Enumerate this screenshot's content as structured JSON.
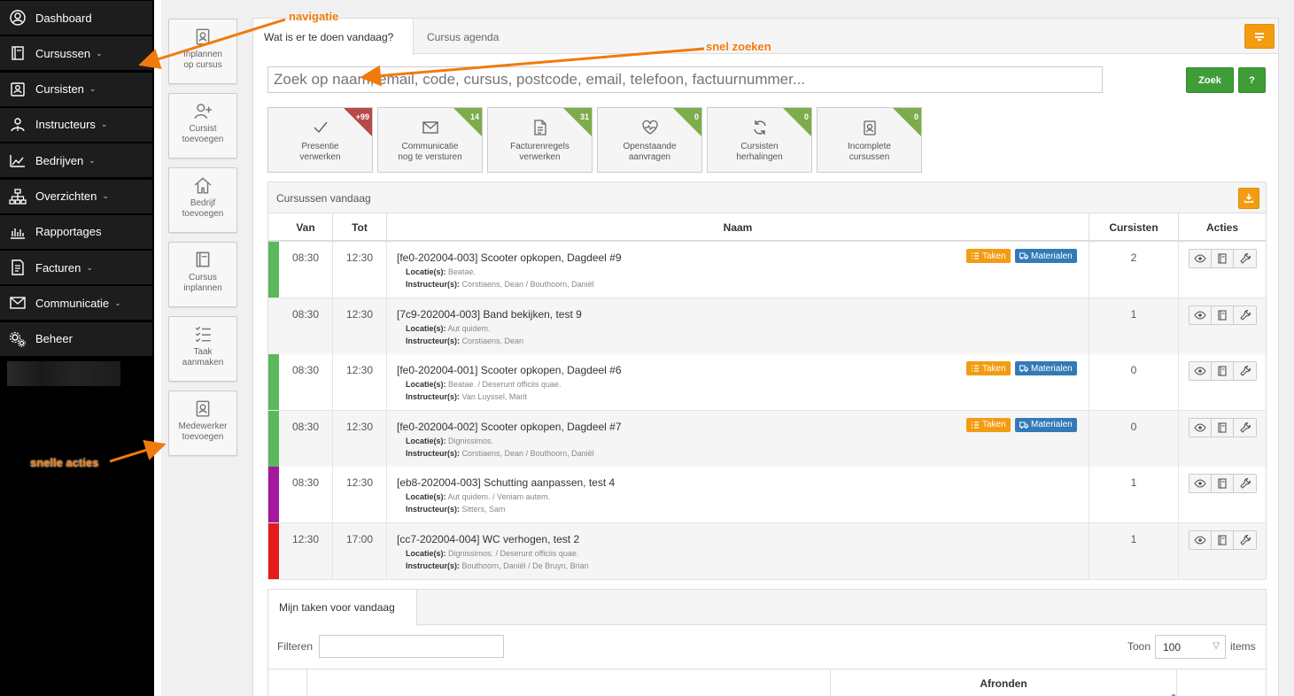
{
  "sidebar": {
    "items": [
      {
        "label": "Dashboard",
        "icon": "user-circle-icon",
        "chevron": ""
      },
      {
        "label": "Cursussen",
        "icon": "book-icon",
        "chevron": "⌄"
      },
      {
        "label": "Cursisten",
        "icon": "id-card-icon",
        "chevron": "⌄"
      },
      {
        "label": "Instructeurs",
        "icon": "instructor-icon",
        "chevron": "⌄"
      },
      {
        "label": "Bedrijven",
        "icon": "factory-icon",
        "chevron": "⌄"
      },
      {
        "label": "Overzichten",
        "icon": "sitemap-icon",
        "chevron": "⌄"
      },
      {
        "label": "Rapportages",
        "icon": "bar-chart-icon",
        "chevron": ""
      },
      {
        "label": "Facturen",
        "icon": "invoice-icon",
        "chevron": "⌄"
      },
      {
        "label": "Communicatie",
        "icon": "envelope-icon",
        "chevron": "⌄"
      },
      {
        "label": "Beheer",
        "icon": "gears-icon",
        "chevron": ""
      }
    ]
  },
  "quick_actions": [
    {
      "line1": "Inplannen",
      "line2": "op cursus",
      "icon": "badge-icon"
    },
    {
      "line1": "Cursist",
      "line2": "toevoegen",
      "icon": "user-plus-icon"
    },
    {
      "line1": "Bedrijf",
      "line2": "toevoegen",
      "icon": "home-icon"
    },
    {
      "line1": "Cursus",
      "line2": "inplannen",
      "icon": "book-icon"
    },
    {
      "line1": "Taak",
      "line2": "aanmaken",
      "icon": "checklist-icon"
    },
    {
      "line1": "Medewerker",
      "line2": "toevoegen",
      "icon": "badge-icon"
    }
  ],
  "tabs": {
    "active": "Wat is er te doen vandaag?",
    "other": "Cursus agenda"
  },
  "search": {
    "placeholder": "Zoek op naam, email, code, cursus, postcode, email, telefoon, factuurnummer...",
    "button": "Zoek",
    "help": "?"
  },
  "tiles": [
    {
      "line1": "Presentie",
      "line2": "verwerken",
      "count": "+99",
      "color": "#b54a46",
      "icon": "check-icon"
    },
    {
      "line1": "Communicatie",
      "line2": "nog te versturen",
      "count": "14",
      "color": "#7dac4a",
      "icon": "envelope-icon"
    },
    {
      "line1": "Facturenregels",
      "line2": "verwerken",
      "count": "31",
      "color": "#7dac4a",
      "icon": "document-icon"
    },
    {
      "line1": "Openstaande",
      "line2": "aanvragen",
      "count": "0",
      "color": "#7dac4a",
      "icon": "heartbeat-icon"
    },
    {
      "line1": "Cursisten",
      "line2": "herhalingen",
      "count": "0",
      "color": "#7dac4a",
      "icon": "refresh-icon"
    },
    {
      "line1": "Incomplete",
      "line2": "cursussen",
      "count": "0",
      "color": "#7dac4a",
      "icon": "badge-icon"
    }
  ],
  "courses": {
    "title": "Cursussen vandaag",
    "columns": {
      "van": "Van",
      "tot": "Tot",
      "naam": "Naam",
      "cursisten": "Cursisten",
      "acties": "Acties"
    },
    "label_locatie": "Locatie(s):",
    "label_instructeur": "Instructeur(s):",
    "tag_taken": "Taken",
    "tag_materialen": "Materialen",
    "rows": [
      {
        "color": "#5cb85c",
        "van": "08:30",
        "tot": "12:30",
        "naam": "[fe0-202004-003] Scooter opkopen, Dagdeel #9",
        "locatie": "Beatae.",
        "instructeur": "Corstiaens, Dean / Bouthoorn, Daniël",
        "cursisten": "2",
        "tags": true
      },
      {
        "color": "#f5f5f5",
        "van": "08:30",
        "tot": "12:30",
        "naam": "[7c9-202004-003] Band bekijken, test 9",
        "locatie": "Aut quidem.",
        "instructeur": "Corstiaens, Dean",
        "cursisten": "1",
        "tags": false
      },
      {
        "color": "#5cb85c",
        "van": "08:30",
        "tot": "12:30",
        "naam": "[fe0-202004-001] Scooter opkopen, Dagdeel #6",
        "locatie": "Beatae. / Deserunt officiis quae.",
        "instructeur": "Van Luyssel, Marit",
        "cursisten": "0",
        "tags": true
      },
      {
        "color": "#5cb85c",
        "van": "08:30",
        "tot": "12:30",
        "naam": "[fe0-202004-002] Scooter opkopen, Dagdeel #7",
        "locatie": "Dignissimos.",
        "instructeur": "Corstiaens, Dean / Bouthoorn, Daniël",
        "cursisten": "0",
        "tags": true
      },
      {
        "color": "#a3189e",
        "van": "08:30",
        "tot": "12:30",
        "naam": "[eb8-202004-003] Schutting aanpassen, test 4",
        "locatie": "Aut quidem. / Veniam autem.",
        "instructeur": "Sitters, Sam",
        "cursisten": "1",
        "tags": false
      },
      {
        "color": "#e31b1b",
        "van": "12:30",
        "tot": "17:00",
        "naam": "[cc7-202004-004] WC verhogen, test 2",
        "locatie": "Dignissimos. / Deserunt officiis quae.",
        "instructeur": "Bouthoorn, Daniël / De Bruyn, Brian",
        "cursisten": "1",
        "tags": false
      }
    ]
  },
  "tasks": {
    "tab": "Mijn taken voor vandaag",
    "filter_label": "Filteren",
    "show_label": "Toon",
    "show_value": "100",
    "items_label": "items",
    "col_afronden": "Afronden"
  },
  "annotations": {
    "nav": "navigatie",
    "search": "snel zoeken",
    "actions": "snelle acties"
  },
  "colors": {
    "orange": "#f39c12",
    "green": "#3f9d38",
    "blue": "#337ab7",
    "annotation": "#f07b0c"
  }
}
